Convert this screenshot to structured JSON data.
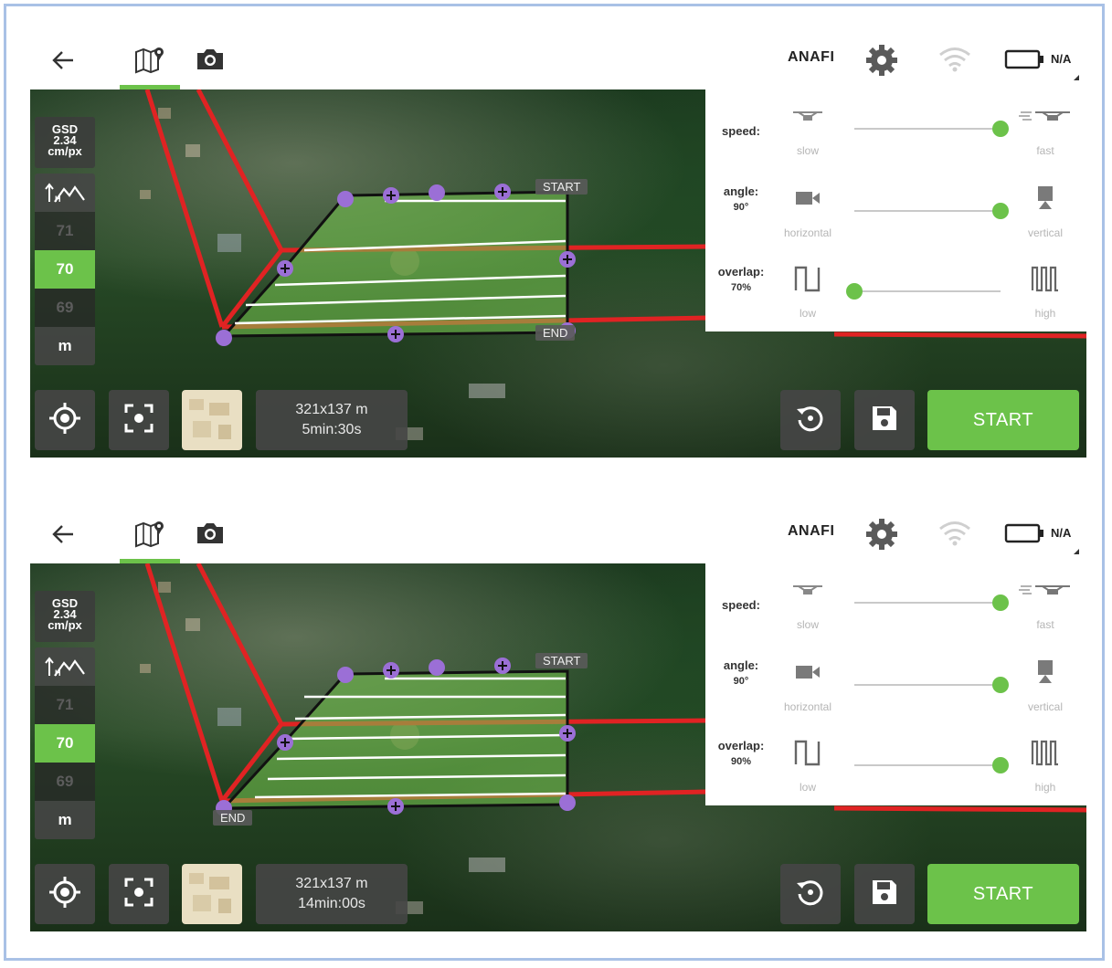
{
  "panels": [
    {
      "brand": "ANAFI",
      "battery": "N/A",
      "gsd": {
        "title": "GSD",
        "value": "2.34",
        "unit": "cm/px"
      },
      "altitude": {
        "above": "71",
        "selected": "70",
        "below": "69",
        "unit": "m"
      },
      "info": {
        "size": "321x137 m",
        "duration": "5min:30s"
      },
      "start_label": "START",
      "map_labels": {
        "start": "START",
        "end": "END"
      },
      "settings": {
        "speed": {
          "label": "speed:",
          "value": "",
          "low": "slow",
          "high": "fast",
          "level": 1.0
        },
        "angle": {
          "label": "angle:",
          "value": "90°",
          "low": "horizontal",
          "high": "vertical",
          "level": 1.0
        },
        "overlap": {
          "label": "overlap:",
          "value": "70%",
          "low": "low",
          "high": "high",
          "level": 0.0
        }
      }
    },
    {
      "brand": "ANAFI",
      "battery": "N/A",
      "gsd": {
        "title": "GSD",
        "value": "2.34",
        "unit": "cm/px"
      },
      "altitude": {
        "above": "71",
        "selected": "70",
        "below": "69",
        "unit": "m"
      },
      "info": {
        "size": "321x137 m",
        "duration": "14min:00s"
      },
      "start_label": "START",
      "map_labels": {
        "start": "START",
        "end": "END"
      },
      "settings": {
        "speed": {
          "label": "speed:",
          "value": "",
          "low": "slow",
          "high": "fast",
          "level": 1.0
        },
        "angle": {
          "label": "angle:",
          "value": "90°",
          "low": "horizontal",
          "high": "vertical",
          "level": 1.0
        },
        "overlap": {
          "label": "overlap:",
          "value": "90%",
          "low": "low",
          "high": "high",
          "level": 1.0
        }
      }
    }
  ],
  "colors": {
    "accent": "#6cc24a",
    "route": "#e02323",
    "waypoint": "#9b6fd6",
    "frame": "#a9c1e6"
  },
  "icons": [
    "back-arrow-icon",
    "map-icon",
    "camera-icon",
    "gear-icon",
    "wifi-icon",
    "battery-icon",
    "terrain-icon",
    "target-icon",
    "focus-icon",
    "rotate-icon",
    "save-icon",
    "slow-drone-icon",
    "fast-drone-icon",
    "horizontal-camera-icon",
    "vertical-camera-icon",
    "low-overlap-icon",
    "high-overlap-icon"
  ]
}
